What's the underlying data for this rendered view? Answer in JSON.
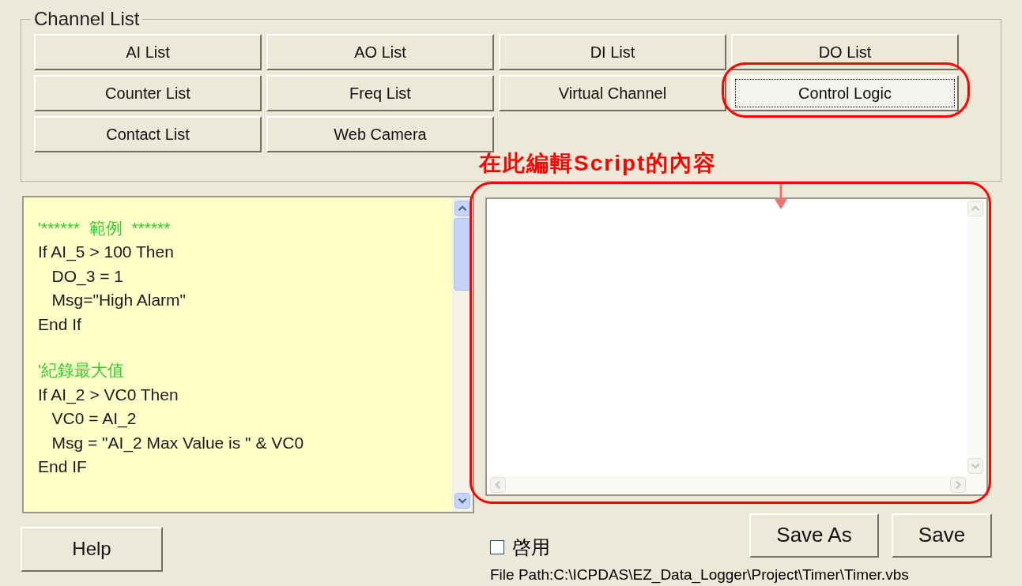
{
  "channel_list": {
    "title": "Channel List",
    "buttons": [
      {
        "label": "AI List",
        "focused": false
      },
      {
        "label": "AO List",
        "focused": false
      },
      {
        "label": "DI List",
        "focused": false
      },
      {
        "label": "DO List",
        "focused": false
      },
      {
        "label": "Counter List",
        "focused": false
      },
      {
        "label": "Freq List",
        "focused": false
      },
      {
        "label": "Virtual Channel",
        "focused": false
      },
      {
        "label": "Control Logic",
        "focused": true,
        "highlighted": true
      },
      {
        "label": "Contact List",
        "focused": false
      },
      {
        "label": "Web Camera",
        "focused": false
      }
    ]
  },
  "annotation": {
    "text": "在此編輯Script的內容"
  },
  "example_code": [
    {
      "kind": "comment",
      "text": "'******  範例  ******"
    },
    {
      "kind": "code",
      "text": "If AI_5 > 100 Then"
    },
    {
      "kind": "code",
      "text": "   DO_3 = 1"
    },
    {
      "kind": "code",
      "text": "   Msg=\"High Alarm\""
    },
    {
      "kind": "code",
      "text": "End If"
    },
    {
      "kind": "blank"
    },
    {
      "kind": "comment",
      "text": "'紀錄最大值"
    },
    {
      "kind": "code",
      "text": "If AI_2 > VC0 Then"
    },
    {
      "kind": "code",
      "text": "   VC0 = AI_2"
    },
    {
      "kind": "code",
      "text": "   Msg = \"AI_2 Max Value is \" & VC0"
    },
    {
      "kind": "code",
      "text": "End IF"
    }
  ],
  "enable_checkbox": {
    "label": "啓用",
    "checked": false
  },
  "buttons": {
    "help": "Help",
    "save_as": "Save As",
    "save": "Save"
  },
  "file_path": "File Path:C:\\ICPDAS\\EZ_Data_Logger\\Project\\Timer\\Timer.vbs"
}
